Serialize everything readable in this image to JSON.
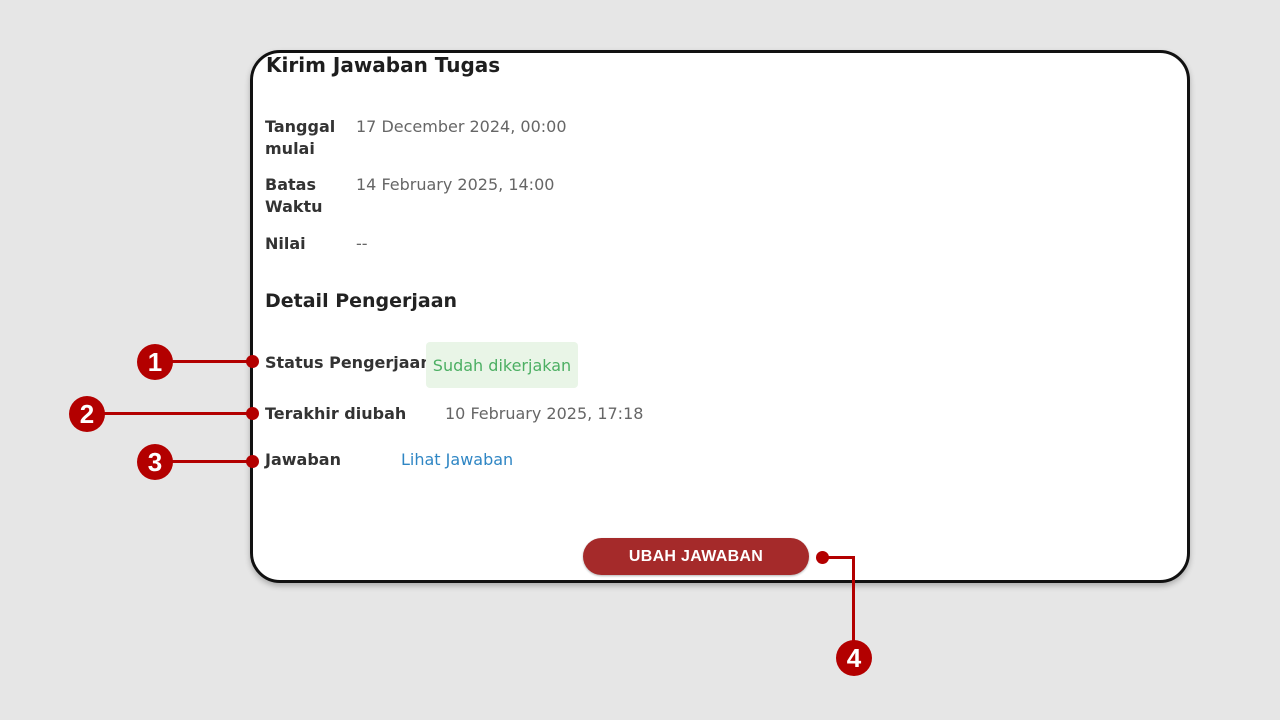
{
  "card": {
    "title": "Kirim Jawaban Tugas",
    "info": [
      {
        "label_line1": "Tanggal",
        "label_line2": "mulai",
        "value": "17 December 2024, 00:00"
      },
      {
        "label_line1": "Batas",
        "label_line2": "Waktu",
        "value": "14 February 2025, 14:00"
      },
      {
        "label_line1": "Nilai",
        "label_line2": "",
        "value": "--"
      }
    ],
    "detail": {
      "heading": "Detail Pengerjaan",
      "status_label": "Status Pengerjaan",
      "status_value": "Sudah dikerjakan",
      "modified_label": "Terakhir diubah",
      "modified_value": "10 February 2025, 17:18",
      "answer_label": "Jawaban",
      "answer_link": "Lihat Jawaban"
    },
    "button_label": "UBAH JAWABAN"
  },
  "callouts": [
    "1",
    "2",
    "3",
    "4"
  ],
  "colors": {
    "accent": "#b30000",
    "button": "#a52a2a",
    "status_green": "#4caf63",
    "status_bg": "#e9f5e7",
    "link": "#2f86c4"
  }
}
